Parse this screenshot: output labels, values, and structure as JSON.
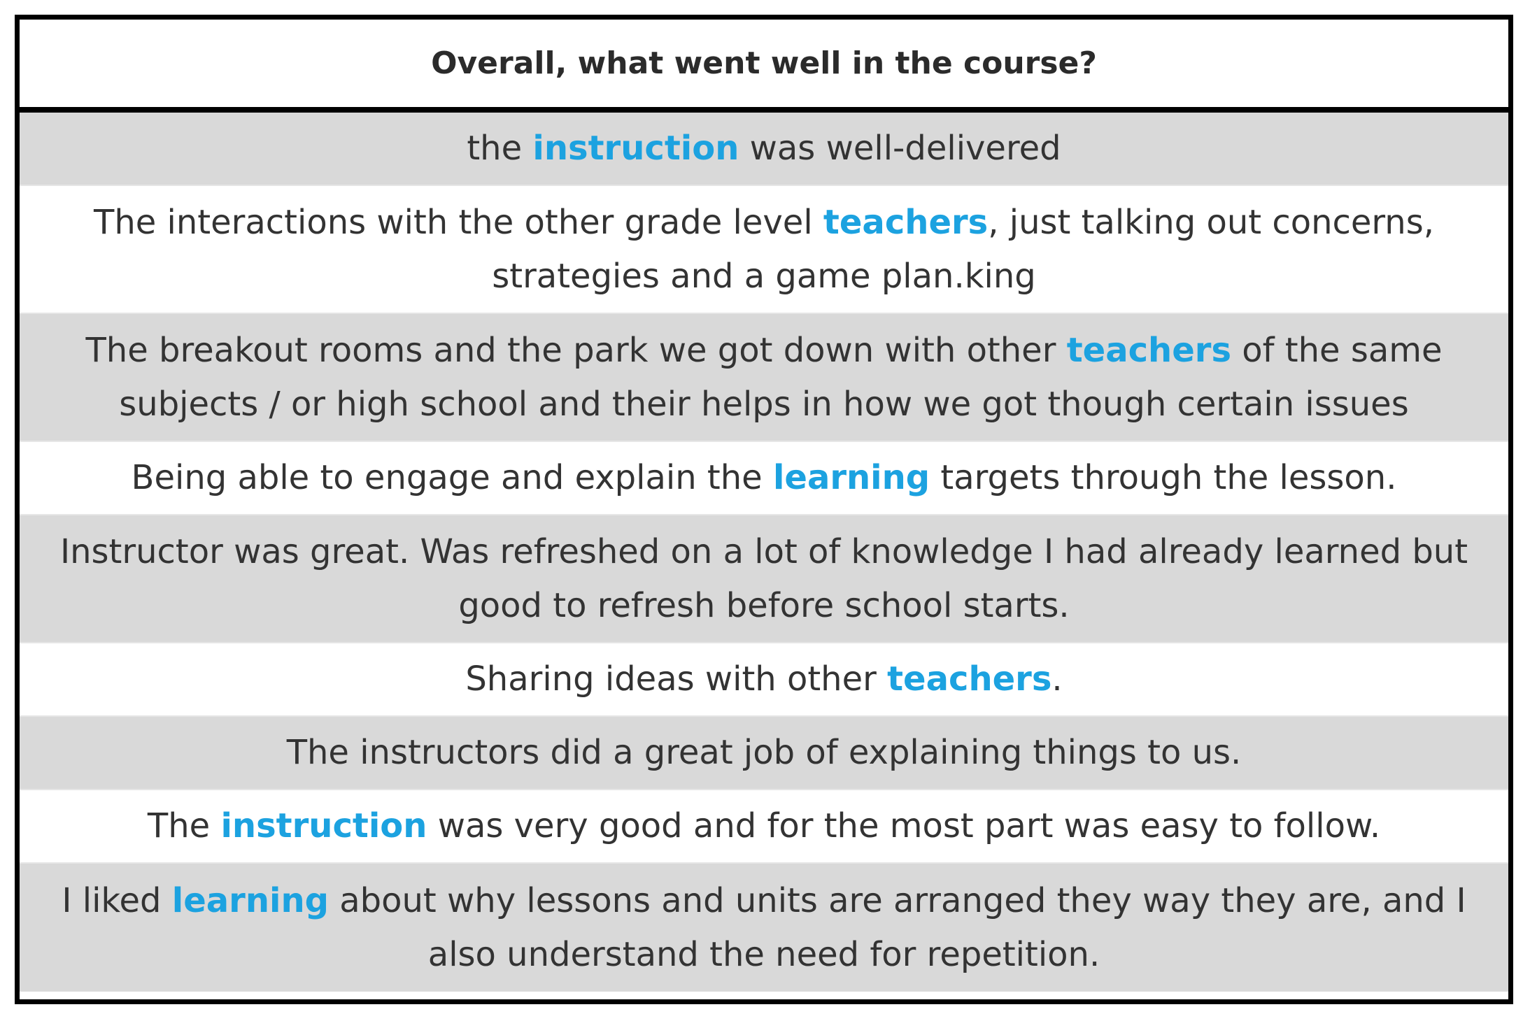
{
  "header": {
    "question": "Overall, what went well in the course?"
  },
  "colors": {
    "keyword": "#1ca2e0",
    "row_shade": "#d9d9d9",
    "row_plain": "#ffffff",
    "text": "#333333",
    "border": "#000000"
  },
  "responses": [
    {
      "segments": [
        {
          "text": "the ",
          "keyword": false
        },
        {
          "text": "instruction",
          "keyword": true
        },
        {
          "text": " was well-delivered",
          "keyword": false
        }
      ]
    },
    {
      "segments": [
        {
          "text": "The interactions with the other grade level ",
          "keyword": false
        },
        {
          "text": "teachers",
          "keyword": true
        },
        {
          "text": ", just talking out concerns, strategies and a game plan.king",
          "keyword": false
        }
      ]
    },
    {
      "segments": [
        {
          "text": "The breakout rooms and the park we got down with other ",
          "keyword": false
        },
        {
          "text": "teachers",
          "keyword": true
        },
        {
          "text": " of the same subjects / or high school and their helps in how we got though certain issues",
          "keyword": false
        }
      ]
    },
    {
      "segments": [
        {
          "text": "Being able to engage and explain the ",
          "keyword": false
        },
        {
          "text": "learning",
          "keyword": true
        },
        {
          "text": " targets through the lesson.",
          "keyword": false
        }
      ]
    },
    {
      "segments": [
        {
          "text": "Instructor was great. Was refreshed on a lot of knowledge I had already learned but good to refresh before school starts.",
          "keyword": false
        }
      ]
    },
    {
      "segments": [
        {
          "text": "Sharing ideas with other ",
          "keyword": false
        },
        {
          "text": "teachers",
          "keyword": true
        },
        {
          "text": ".",
          "keyword": false
        }
      ]
    },
    {
      "segments": [
        {
          "text": "The instructors did a great job of explaining things to us.",
          "keyword": false
        }
      ]
    },
    {
      "segments": [
        {
          "text": "The ",
          "keyword": false
        },
        {
          "text": "instruction",
          "keyword": true
        },
        {
          "text": " was very good and for the most part was easy to follow.",
          "keyword": false
        }
      ]
    },
    {
      "segments": [
        {
          "text": "I liked ",
          "keyword": false
        },
        {
          "text": "learning",
          "keyword": true
        },
        {
          "text": " about why lessons and units are arranged they way they are, and I also understand the need for repetition.",
          "keyword": false
        }
      ]
    }
  ]
}
